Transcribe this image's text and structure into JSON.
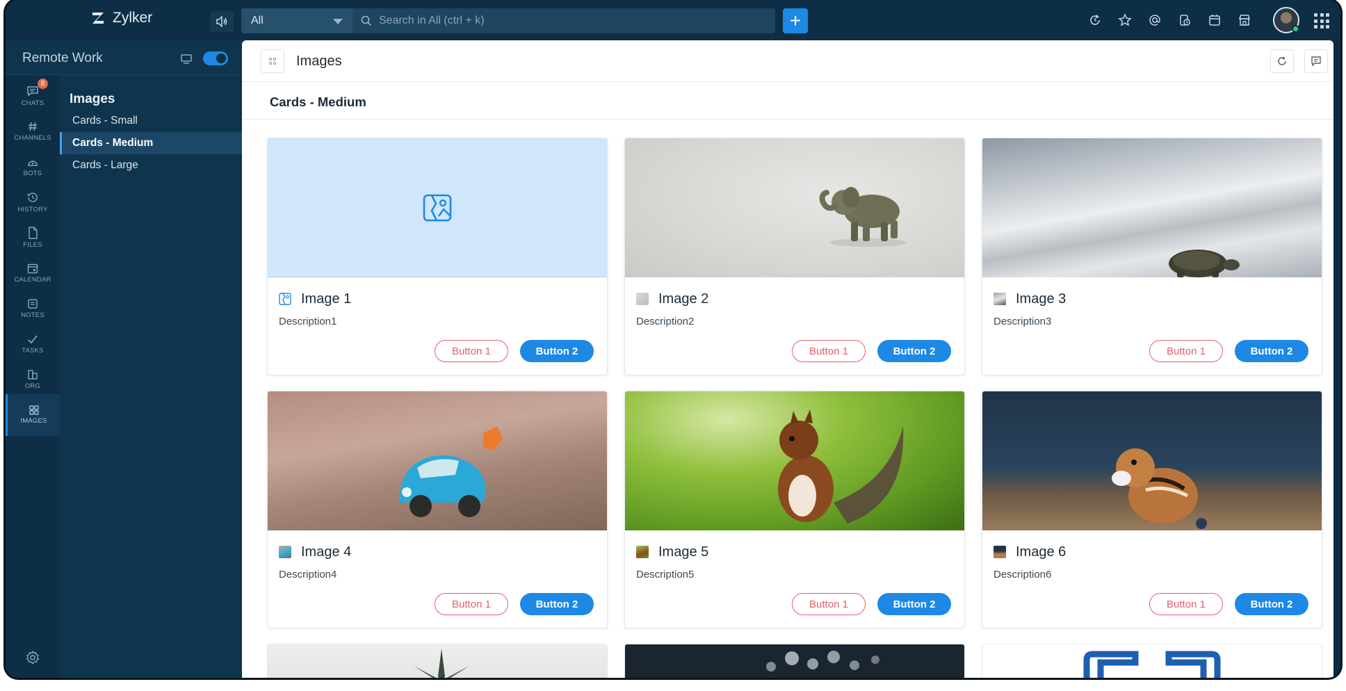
{
  "app": {
    "brand": "Zylker"
  },
  "search": {
    "scope": "All",
    "placeholder": "Search in All (ctrl + k)"
  },
  "workspace": {
    "name": "Remote Work",
    "toggle_on": true
  },
  "rail": [
    {
      "label": "CHATS",
      "icon": "chat-icon",
      "badge": "8"
    },
    {
      "label": "CHANNELS",
      "icon": "hash-icon"
    },
    {
      "label": "BOTS",
      "icon": "bot-icon"
    },
    {
      "label": "HISTORY",
      "icon": "history-icon"
    },
    {
      "label": "FILES",
      "icon": "file-icon"
    },
    {
      "label": "CALENDAR",
      "icon": "calendar-icon"
    },
    {
      "label": "NOTES",
      "icon": "notes-icon"
    },
    {
      "label": "TASKS",
      "icon": "tasks-icon"
    },
    {
      "label": "ORG",
      "icon": "org-icon"
    },
    {
      "label": "IMAGES",
      "icon": "images-icon",
      "active": true
    }
  ],
  "subnav": {
    "title": "Images",
    "items": [
      {
        "label": "Cards - Small"
      },
      {
        "label": "Cards - Medium",
        "active": true
      },
      {
        "label": "Cards - Large"
      }
    ]
  },
  "main": {
    "title": "Images",
    "section": "Cards - Medium"
  },
  "cards": [
    {
      "title": "Image 1",
      "description": "Description1",
      "button1": "Button 1",
      "button2": "Button 2"
    },
    {
      "title": "Image 2",
      "description": "Description2",
      "button1": "Button 1",
      "button2": "Button 2"
    },
    {
      "title": "Image 3",
      "description": "Description3",
      "button1": "Button 1",
      "button2": "Button 2"
    },
    {
      "title": "Image 4",
      "description": "Description4",
      "button1": "Button 1",
      "button2": "Button 2"
    },
    {
      "title": "Image 5",
      "description": "Description5",
      "button1": "Button 1",
      "button2": "Button 2"
    },
    {
      "title": "Image 6",
      "description": "Description6",
      "button1": "Button 1",
      "button2": "Button 2"
    }
  ],
  "colors": {
    "accent": "#1e88e5",
    "sidebar": "#0d2e45",
    "danger_outline": "#e5606a"
  }
}
